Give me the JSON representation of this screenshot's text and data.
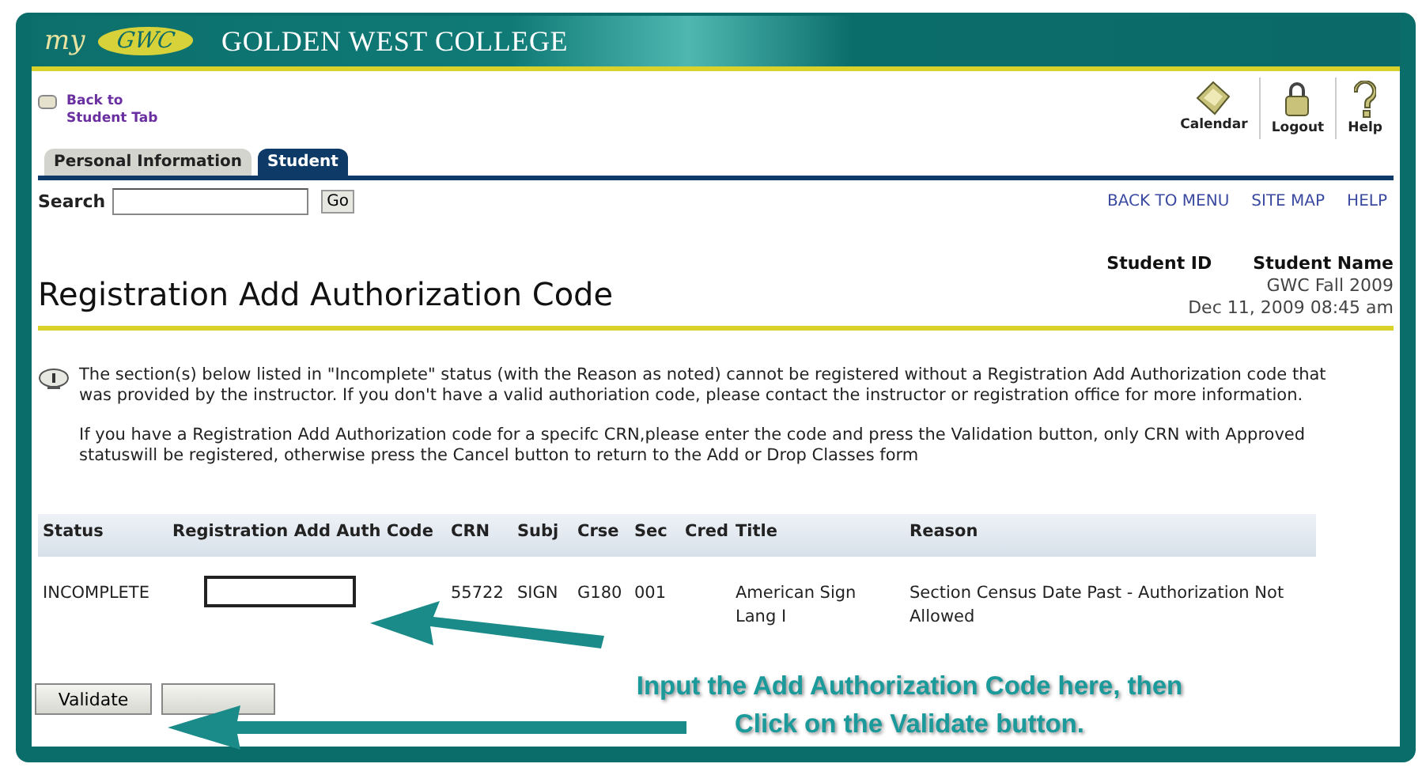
{
  "header": {
    "logo_prefix": "my",
    "logo": "GWC",
    "title": "GOLDEN WEST COLLEGE"
  },
  "back_link": {
    "lines": [
      "Back to",
      "Student Tab"
    ]
  },
  "toolbar": [
    {
      "label": "Calendar",
      "kind": "calendar"
    },
    {
      "label": "Logout",
      "kind": "logout"
    },
    {
      "label": "Help",
      "kind": "help"
    }
  ],
  "tabs": [
    {
      "label": "Personal Information",
      "selected": false
    },
    {
      "label": "Student",
      "selected": true
    }
  ],
  "search": {
    "label": "Search",
    "button": "Go"
  },
  "nav_links": [
    "BACK TO MENU",
    "SITE MAP",
    "HELP"
  ],
  "page_title": "Registration Add Authorization Code",
  "student": {
    "id_label": "Student ID",
    "name_label": "Student Name",
    "term": "GWC Fall 2009",
    "datetime": "Dec 11, 2009 08:45 am"
  },
  "info": [
    "The section(s) below listed in \"Incomplete\" status (with the Reason as noted) cannot be registered without a Registration Add Authorization code that was provided by the instructor. If you don't have a valid authoriation code, please contact the instructor or registration office for more information.",
    "If you have a Registration Add Authorization code for a specifc CRN,please enter the code and press the Validation button, only CRN with Approved statuswill be registered, otherwise press the Cancel button to return to the Add or Drop Classes form"
  ],
  "table": {
    "columns": [
      "Status",
      "Registration Add Auth Code",
      "CRN",
      "Subj",
      "Crse",
      "Sec",
      "Cred",
      "Title",
      "Reason"
    ],
    "rows": [
      {
        "status": "INCOMPLETE",
        "crn": "55722",
        "subj": "SIGN",
        "crse": "G180",
        "sec": "001",
        "title": "American Sign Lang I",
        "reason": "Section Census Date Past - Authorization Not Allowed"
      }
    ]
  },
  "buttons": [
    {
      "kind": "button",
      "label": "Validate"
    },
    {
      "kind": "covered"
    }
  ],
  "callout": [
    "Input the Add Authorization Code here, then",
    "Click on the Validate button."
  ]
}
